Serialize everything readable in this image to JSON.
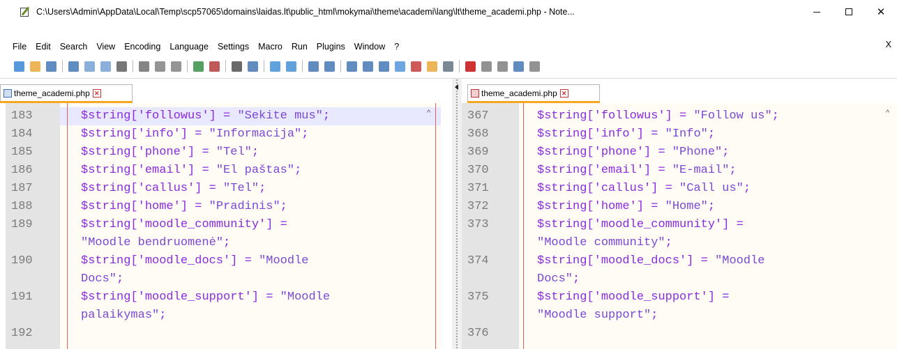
{
  "window": {
    "title": "C:\\Users\\Admin\\AppData\\Local\\Temp\\scp57065\\domains\\laidas.lt\\public_html\\mokymai\\theme\\academi\\lang\\lt\\theme_academi.php - Note...",
    "close_label": "✕",
    "max_label": "",
    "min_label": ""
  },
  "menu": {
    "items": [
      "File",
      "Edit",
      "Search",
      "View",
      "Encoding",
      "Language",
      "Settings",
      "Macro",
      "Run",
      "Plugins",
      "Window",
      "?"
    ],
    "close_label": "X"
  },
  "toolbar": {
    "icons": [
      "new-file-icon",
      "open-file-icon",
      "save-icon",
      "save-all-icon",
      "close-icon",
      "close-all-icon",
      "print-icon",
      "cut-icon",
      "copy-icon",
      "paste-icon",
      "undo-icon",
      "redo-icon",
      "find-icon",
      "replace-icon",
      "zoom-in-icon",
      "zoom-out-icon",
      "sync-vertical-icon",
      "sync-horizontal-icon",
      "word-wrap-icon",
      "show-all-chars-icon",
      "indent-guide-icon",
      "doc-map-icon",
      "function-list-icon",
      "folder-workspace-icon",
      "monitoring-icon",
      "record-macro-icon",
      "stop-macro-icon",
      "play-macro-icon",
      "run-macro-multiple-icon",
      "save-macro-icon"
    ]
  },
  "left_pane": {
    "tab_label": "theme_academi.php",
    "lines": [
      {
        "num": "183",
        "parts": [
          [
            "var",
            "$string"
          ],
          [
            "op",
            "['followus'] = "
          ],
          [
            "str",
            "\"Sekite mus\""
          ],
          [
            "op",
            ";"
          ]
        ]
      },
      {
        "num": "184",
        "parts": [
          [
            "var",
            "$string"
          ],
          [
            "op",
            "['info'] = "
          ],
          [
            "str",
            "\"Informacija\""
          ],
          [
            "op",
            ";"
          ]
        ]
      },
      {
        "num": "185",
        "parts": [
          [
            "var",
            "$string"
          ],
          [
            "op",
            "['phone'] = "
          ],
          [
            "str",
            "\"Tel\""
          ],
          [
            "op",
            ";"
          ]
        ]
      },
      {
        "num": "186",
        "parts": [
          [
            "var",
            "$string"
          ],
          [
            "op",
            "['email'] = "
          ],
          [
            "str",
            "\"El paštas\""
          ],
          [
            "op",
            ";"
          ]
        ]
      },
      {
        "num": "187",
        "parts": [
          [
            "var",
            "$string"
          ],
          [
            "op",
            "['callus'] = "
          ],
          [
            "str",
            "\"Tel\""
          ],
          [
            "op",
            ";"
          ]
        ]
      },
      {
        "num": "188",
        "parts": [
          [
            "var",
            "$string"
          ],
          [
            "op",
            "['home'] = "
          ],
          [
            "str",
            "\"Pradinis\""
          ],
          [
            "op",
            ";"
          ]
        ]
      },
      {
        "num": "189",
        "parts": [
          [
            "var",
            "$string"
          ],
          [
            "op",
            "['moodle_community'] ="
          ]
        ]
      },
      {
        "num": "",
        "parts": [
          [
            "str",
            "\"Moodle bendruomenė\""
          ],
          [
            "op",
            ";"
          ]
        ]
      },
      {
        "num": "190",
        "parts": [
          [
            "var",
            "$string"
          ],
          [
            "op",
            "['moodle_docs'] = "
          ],
          [
            "str",
            "\"Moodle"
          ]
        ]
      },
      {
        "num": "",
        "parts": [
          [
            "str",
            "Docs\""
          ],
          [
            "op",
            ";"
          ]
        ]
      },
      {
        "num": "191",
        "parts": [
          [
            "var",
            "$string"
          ],
          [
            "op",
            "['moodle_support'] = "
          ],
          [
            "str",
            "\"Moodle"
          ]
        ]
      },
      {
        "num": "",
        "parts": [
          [
            "str",
            "palaikymas\""
          ],
          [
            "op",
            ";"
          ]
        ]
      },
      {
        "num": "192",
        "parts": []
      }
    ]
  },
  "right_pane": {
    "tab_label": "theme_academi.php",
    "lines": [
      {
        "num": "367",
        "parts": [
          [
            "var",
            "$string"
          ],
          [
            "op",
            "['followus'] = "
          ],
          [
            "str",
            "\"Follow us\""
          ],
          [
            "op",
            ";"
          ]
        ]
      },
      {
        "num": "368",
        "parts": [
          [
            "var",
            "$string"
          ],
          [
            "op",
            "['info'] = "
          ],
          [
            "str",
            "\"Info\""
          ],
          [
            "op",
            ";"
          ]
        ]
      },
      {
        "num": "369",
        "parts": [
          [
            "var",
            "$string"
          ],
          [
            "op",
            "['phone'] = "
          ],
          [
            "str",
            "\"Phone\""
          ],
          [
            "op",
            ";"
          ]
        ]
      },
      {
        "num": "370",
        "parts": [
          [
            "var",
            "$string"
          ],
          [
            "op",
            "['email'] = "
          ],
          [
            "str",
            "\"E-mail\""
          ],
          [
            "op",
            ";"
          ]
        ]
      },
      {
        "num": "371",
        "parts": [
          [
            "var",
            "$string"
          ],
          [
            "op",
            "['callus'] = "
          ],
          [
            "str",
            "\"Call us\""
          ],
          [
            "op",
            ";"
          ]
        ]
      },
      {
        "num": "372",
        "parts": [
          [
            "var",
            "$string"
          ],
          [
            "op",
            "['home'] = "
          ],
          [
            "str",
            "\"Home\""
          ],
          [
            "op",
            ";"
          ]
        ]
      },
      {
        "num": "373",
        "parts": [
          [
            "var",
            "$string"
          ],
          [
            "op",
            "['moodle_community'] ="
          ]
        ]
      },
      {
        "num": "",
        "parts": [
          [
            "str",
            "\"Moodle community\""
          ],
          [
            "op",
            ";"
          ]
        ]
      },
      {
        "num": "374",
        "parts": [
          [
            "var",
            "$string"
          ],
          [
            "op",
            "['moodle_docs'] = "
          ],
          [
            "str",
            "\"Moodle"
          ]
        ]
      },
      {
        "num": "",
        "parts": [
          [
            "str",
            "Docs\""
          ],
          [
            "op",
            ";"
          ]
        ]
      },
      {
        "num": "375",
        "parts": [
          [
            "var",
            "$string"
          ],
          [
            "op",
            "['moodle_support'] ="
          ]
        ]
      },
      {
        "num": "",
        "parts": [
          [
            "str",
            "\"Moodle support\""
          ],
          [
            "op",
            ";"
          ]
        ]
      },
      {
        "num": "376",
        "parts": []
      }
    ]
  },
  "colors": {
    "keyword": "#8a2be2",
    "string": "#7b48d6",
    "line_number": "#7a7a7a",
    "editor_bg": "#fefcf5",
    "gutter_bg": "#e4e4e4",
    "current_line": "#e8e8ff",
    "active_tab_accent": "#f5a623"
  }
}
